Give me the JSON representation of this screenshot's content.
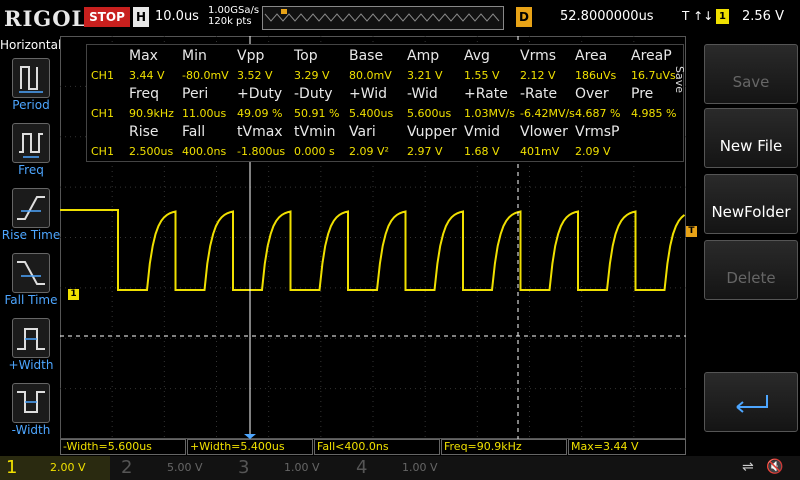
{
  "topbar": {
    "logo": "RIGOL",
    "run_state": "STOP",
    "timebase_label": "H",
    "timebase_value": "10.0us",
    "sample_rate": "1.00GSa/s",
    "memory_depth": "120k pts",
    "delay_label": "D",
    "delay_value": "52.8000000us",
    "trigger_label": "T",
    "trigger_channel": "1",
    "trigger_level": "2.56 V"
  },
  "left_panel": {
    "title": "Horizontal",
    "buttons": [
      {
        "label": "Period",
        "icon": "period-icon"
      },
      {
        "label": "Freq",
        "icon": "freq-icon"
      },
      {
        "label": "Rise Time",
        "icon": "rise-time-icon"
      },
      {
        "label": "Fall Time",
        "icon": "fall-time-icon"
      },
      {
        "label": "+Width",
        "icon": "pos-width-icon"
      },
      {
        "label": "-Width",
        "icon": "neg-width-icon"
      }
    ]
  },
  "right_panel": {
    "title": "Save",
    "buttons": [
      {
        "label": "Save",
        "enabled": false
      },
      {
        "label": "New File",
        "enabled": true
      },
      {
        "label": "NewFolder",
        "enabled": true
      },
      {
        "label": "Delete",
        "enabled": false
      },
      {
        "label": "",
        "icon": "return-arrow-icon",
        "enabled": true
      }
    ]
  },
  "measurements": {
    "rows": [
      {
        "type": "header",
        "cells": [
          "Max",
          "Min",
          "Vpp",
          "Top",
          "Base",
          "Amp",
          "Avg",
          "Vrms",
          "Area",
          "AreaP"
        ]
      },
      {
        "type": "value",
        "channel": "CH1",
        "cells": [
          "3.44 V",
          "-80.0mV",
          "3.52 V",
          "3.29 V",
          "80.0mV",
          "3.21 V",
          "1.55 V",
          "2.12 V",
          "186uVs",
          "16.7uVs"
        ]
      },
      {
        "type": "header",
        "cells": [
          "Freq",
          "Peri",
          "+Duty",
          "-Duty",
          "+Wid",
          "-Wid",
          "+Rate",
          "-Rate",
          "Over",
          "Pre"
        ]
      },
      {
        "type": "value",
        "channel": "CH1",
        "cells": [
          "90.9kHz",
          "11.00us",
          "49.09 %",
          "50.91 %",
          "5.400us",
          "5.600us",
          "1.03MV/s",
          "-6.42MV/s",
          "4.687 %",
          "4.985 %"
        ]
      },
      {
        "type": "header",
        "cells": [
          "Rise",
          "Fall",
          "tVmax",
          "tVmin",
          "Vari",
          "Vupper",
          "Vmid",
          "Vlower",
          "VrmsP",
          ""
        ]
      },
      {
        "type": "value",
        "channel": "CH1",
        "cells": [
          "2.500us",
          "400.0ns",
          "-1.800us",
          "0.000 s",
          "2.09 V²",
          "2.97 V",
          "1.68 V",
          "401mV",
          "2.09 V",
          ""
        ]
      }
    ]
  },
  "info_bar": [
    "-Width=5.600us",
    "+Width=5.400us",
    "Fall<400.0ns",
    "Freq=90.9kHz",
    "Max=3.44 V"
  ],
  "channels": [
    {
      "num": "1",
      "scale": "2.00 V",
      "color": "#f0e000",
      "active": true
    },
    {
      "num": "2",
      "scale": "5.00 V",
      "color": "#00c0c0",
      "active": false
    },
    {
      "num": "3",
      "scale": "1.00 V",
      "color": "#d040d0",
      "active": false
    },
    {
      "num": "4",
      "scale": "1.00 V",
      "color": "#3070ff",
      "active": false
    }
  ],
  "markers": {
    "ch1_marker": "1",
    "trigger_marker": "T"
  },
  "colors": {
    "ch1": "#f0e000",
    "accent": "#e8a317",
    "label_blue": "#4da6ff",
    "stop_red": "#c8201e"
  }
}
